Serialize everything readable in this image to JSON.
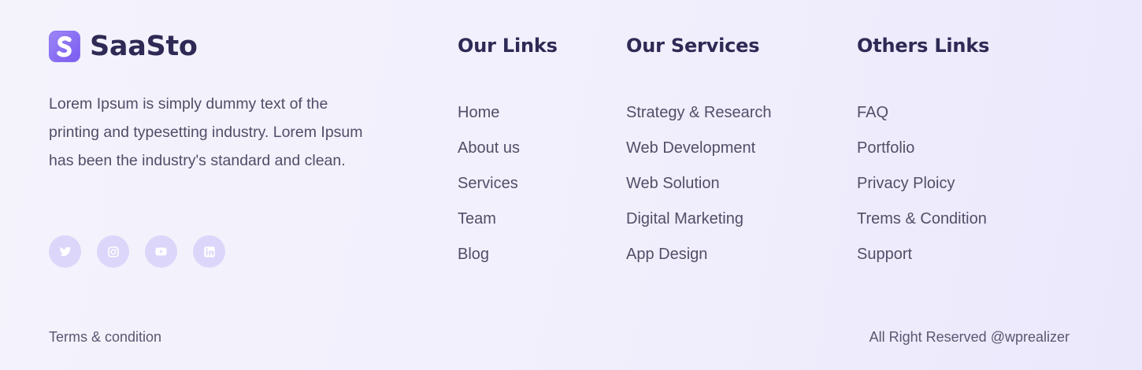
{
  "brand": {
    "name": "SaaSto",
    "logo_icon": "saasto-logo-icon"
  },
  "about": {
    "text": "Lorem Ipsum is simply dummy text of the printing and typesetting industry. Lorem Ipsum has been the industry's standard and clean."
  },
  "socials": [
    {
      "icon": "twitter-icon"
    },
    {
      "icon": "instagram-icon"
    },
    {
      "icon": "youtube-icon"
    },
    {
      "icon": "linkedin-icon"
    }
  ],
  "columns": [
    {
      "heading": "Our Links",
      "items": [
        "Home",
        "About us",
        "Services",
        "Team",
        "Blog"
      ]
    },
    {
      "heading": "Our Services",
      "items": [
        "Strategy & Research",
        "Web Development",
        "Web Solution",
        "Digital Marketing",
        "App Design"
      ]
    },
    {
      "heading": "Others Links",
      "items": [
        "FAQ",
        "Portfolio",
        "Privacy Ploicy",
        "Trems & Condition",
        "Support"
      ]
    }
  ],
  "bottom": {
    "terms": "Terms & condition",
    "copyright": "All Right Reserved @wprealizer"
  },
  "colors": {
    "heading": "#2e2a55",
    "accent": "#7a5cf0",
    "social_bg": "#dcd6fa",
    "text": "#524e68"
  }
}
